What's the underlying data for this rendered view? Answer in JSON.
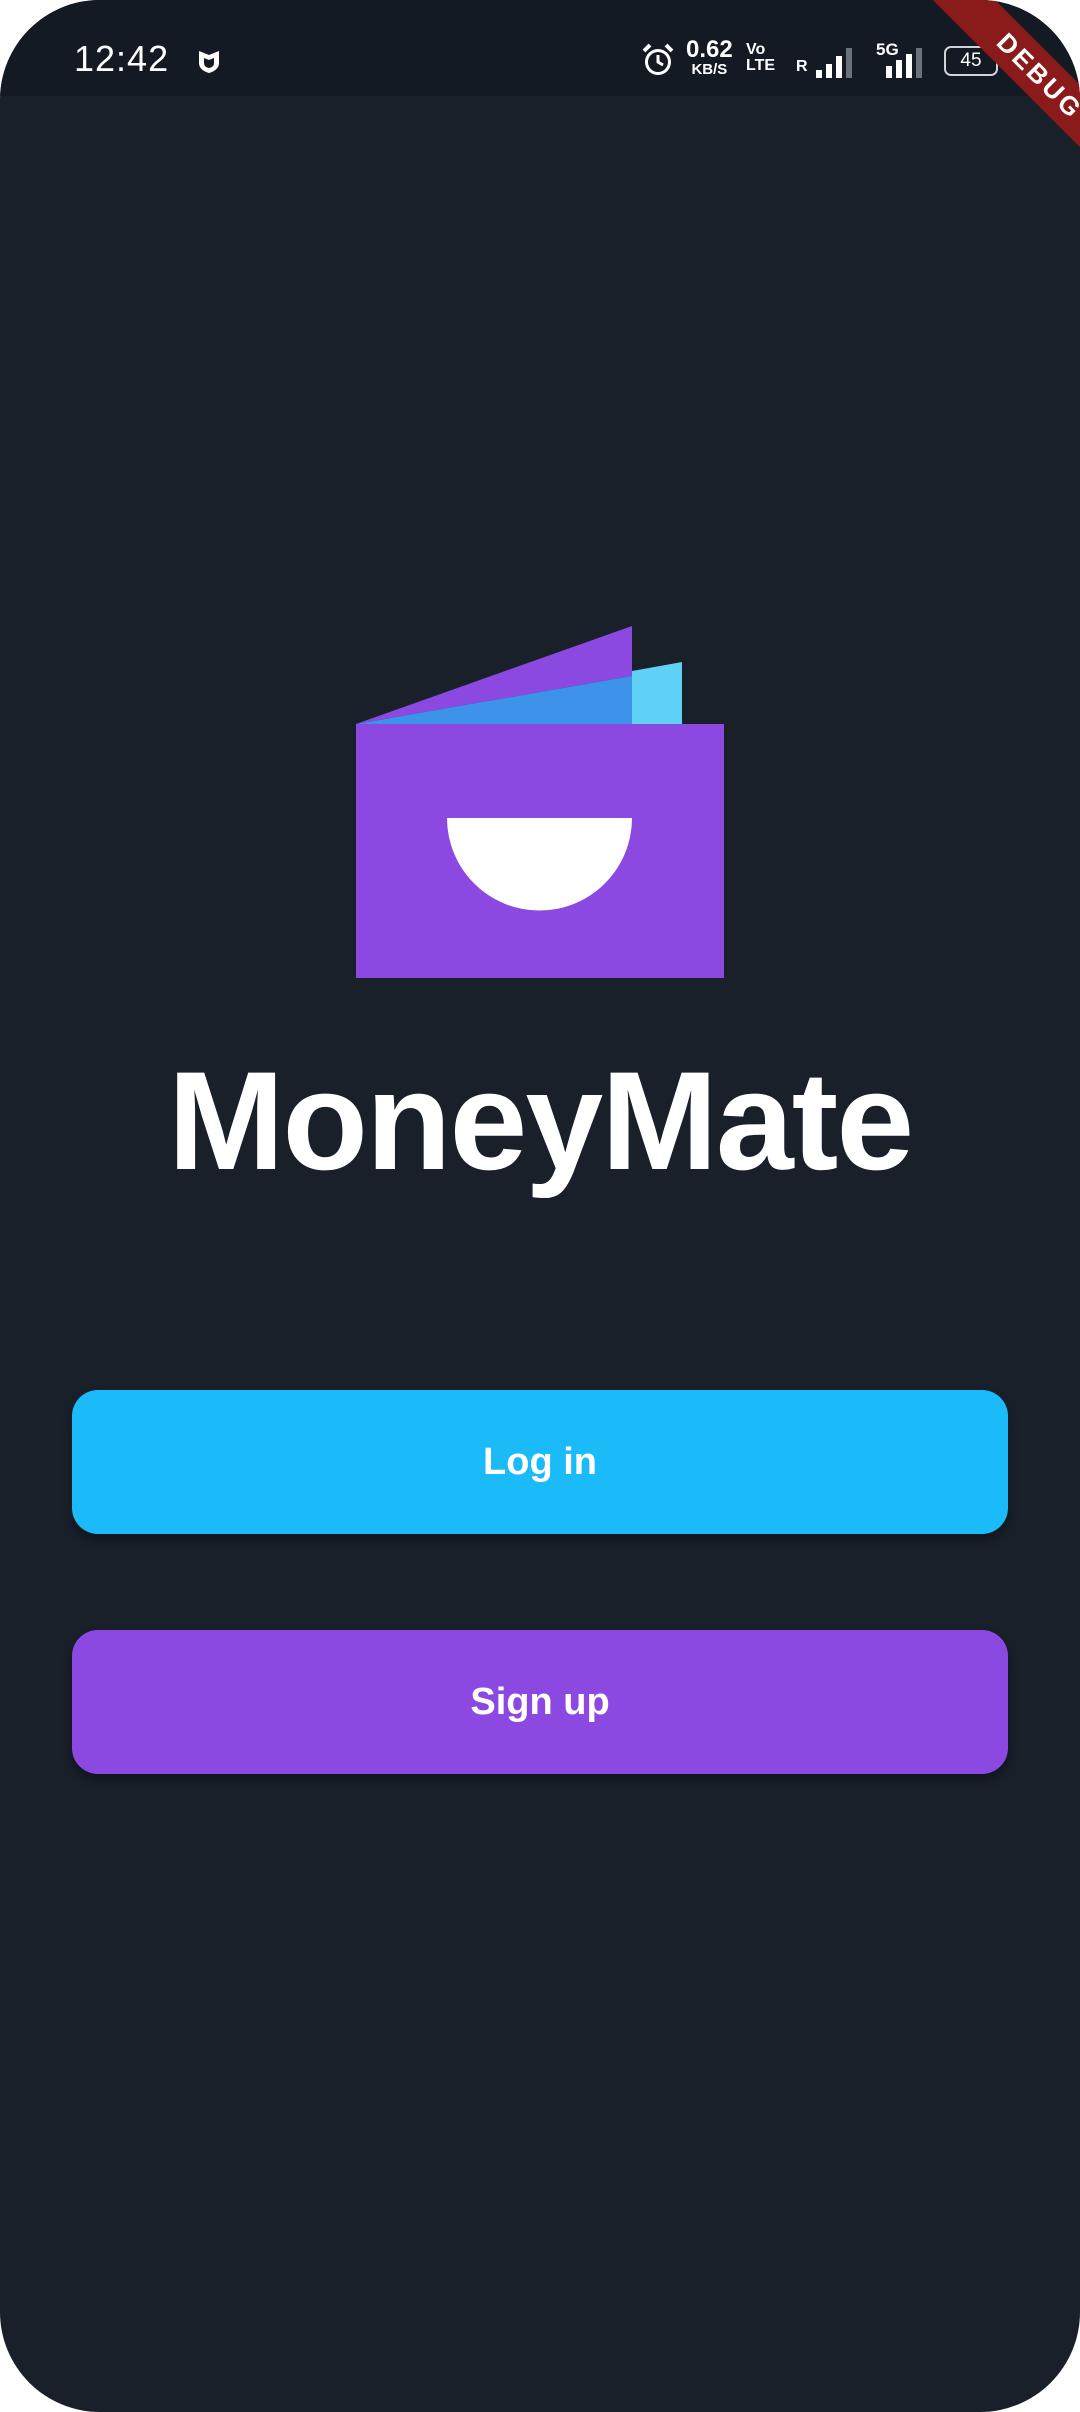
{
  "status_bar": {
    "time": "12:42",
    "speed_value": "0.62",
    "speed_unit": "KB/S",
    "volte_line1": "Vo",
    "volte_line2": "LTE",
    "roaming": "R",
    "network_type": "5G",
    "battery": "45",
    "icons": [
      "shield-icon",
      "alarm-icon",
      "signal-icon",
      "signal-icon",
      "battery-icon"
    ]
  },
  "debug_banner": "DEBUG",
  "app": {
    "title": "MoneyMate",
    "logo": "wallet-logo"
  },
  "actions": {
    "login_label": "Log in",
    "signup_label": "Sign up"
  },
  "colors": {
    "background": "#19202a",
    "login_button": "#1abbf8",
    "signup_button": "#8c49e2",
    "logo_purple": "#8c49e2",
    "logo_blue": "#3d93ea",
    "logo_cyan": "#5fd0f6",
    "debug_ribbon": "#8b1a1a"
  }
}
